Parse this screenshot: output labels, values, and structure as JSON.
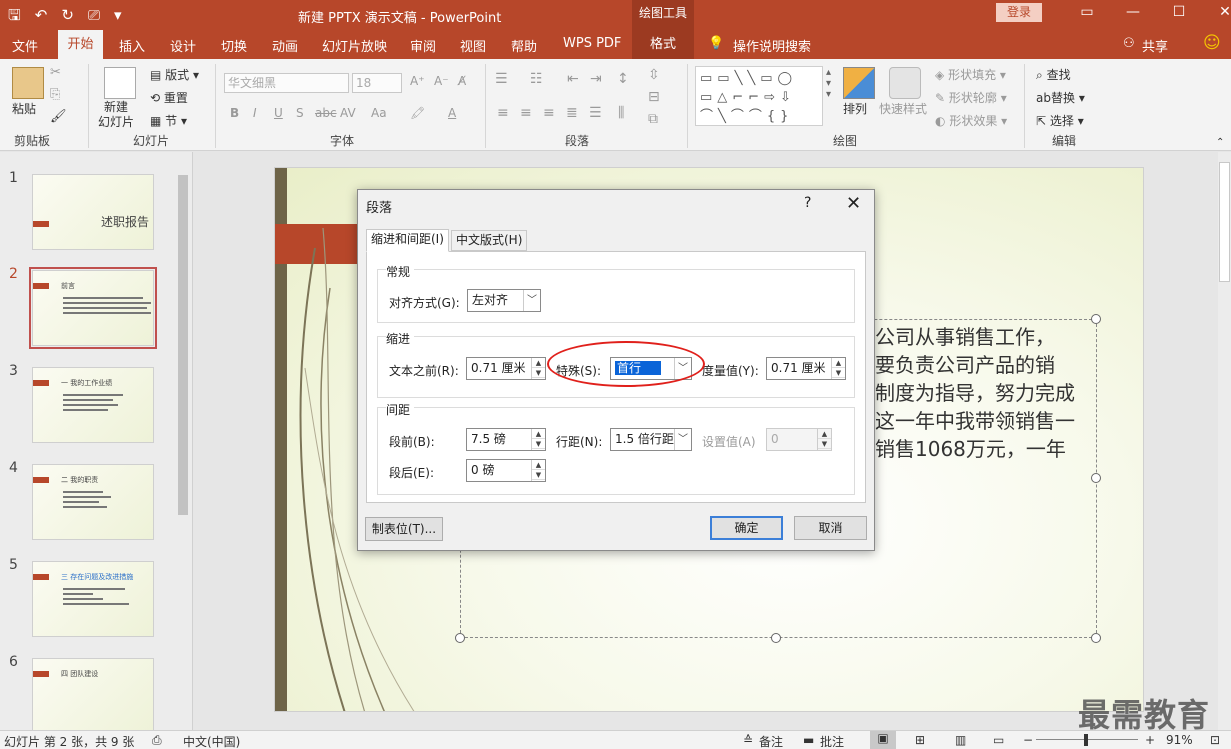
{
  "window": {
    "title": "新建 PPTX 演示文稿 - PowerPoint",
    "context_tab": "绘图工具",
    "login_label": "登录"
  },
  "tabs": [
    "文件",
    "开始",
    "插入",
    "设计",
    "切换",
    "动画",
    "幻灯片放映",
    "审阅",
    "视图",
    "帮助",
    "WPS PDF",
    "格式"
  ],
  "tell_me": "操作说明搜索",
  "share": "共享",
  "ribbon": {
    "clipboard": {
      "paste": "粘贴",
      "group": "剪贴板"
    },
    "slides": {
      "new_slide": "新建\n幻灯片",
      "layout": "版式",
      "reset": "重置",
      "section": "节",
      "group": "幻灯片"
    },
    "font": {
      "font_name": "华文细黑",
      "font_size": "18",
      "bold": "B",
      "italic": "I",
      "underline": "U",
      "shadow": "S",
      "strike": "abc",
      "spacing": "AV",
      "case": "Aa",
      "clear": "A",
      "highlight": "A",
      "group": "字体"
    },
    "paragraph": {
      "group": "段落"
    },
    "drawing": {
      "arrange": "排列",
      "quick_styles": "快速样式",
      "shape_fill": "形状填充",
      "shape_outline": "形状轮廓",
      "shape_effects": "形状效果",
      "group": "绘图"
    },
    "editing": {
      "find": "查找",
      "replace": "替换",
      "select": "选择",
      "group": "编辑"
    }
  },
  "thumbnails": [
    {
      "num": "1",
      "title": "述职报告"
    },
    {
      "num": "2",
      "title": "前言"
    },
    {
      "num": "3",
      "title": "一 我的工作业绩"
    },
    {
      "num": "4",
      "title": "二 我的职责"
    },
    {
      "num": "5",
      "title": "三 存在问题及改进措施"
    },
    {
      "num": "6",
      "title": "四 团队建设"
    }
  ],
  "selected_slide": 2,
  "slide": {
    "text_lines": [
      "公司从事销售工作，",
      "要负责公司产品的销",
      "制度为指导，努力完成",
      "这一年中我带领销售一",
      "销售1068万元，一年"
    ]
  },
  "dialog": {
    "title": "段落",
    "help": "?",
    "tabs": [
      "缩进和间距(I)",
      "中文版式(H)"
    ],
    "general": {
      "header": "常规",
      "align_label": "对齐方式(G):",
      "align_value": "左对齐"
    },
    "indent": {
      "header": "缩进",
      "before_label": "文本之前(R):",
      "before_value": "0.71 厘米",
      "special_label": "特殊(S):",
      "special_value": "首行",
      "measure_label": "度量值(Y):",
      "measure_value": "0.71 厘米"
    },
    "spacing": {
      "header": "间距",
      "before_label": "段前(B):",
      "before_value": "7.5 磅",
      "after_label": "段后(E):",
      "after_value": "0 磅",
      "line_label": "行距(N):",
      "line_value": "1.5 倍行距",
      "at_label": "设置值(A)",
      "at_value": "0"
    },
    "tabs_button": "制表位(T)...",
    "ok": "确定",
    "cancel": "取消"
  },
  "status": {
    "slide_info": "幻灯片 第 2 张，共 9 张",
    "language": "中文(中国)",
    "notes": "备注",
    "comments": "批注",
    "zoom": "91%"
  },
  "watermark": "最需教育"
}
